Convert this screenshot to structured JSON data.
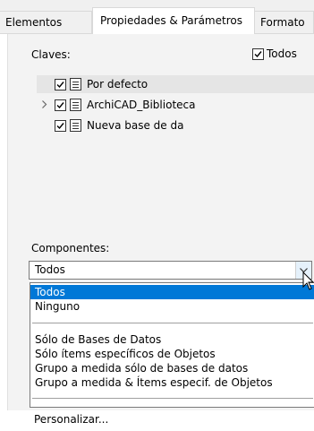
{
  "tabs": [
    {
      "label": "Elementos",
      "active": false
    },
    {
      "label": "Propiedades & Parámetros",
      "active": true
    },
    {
      "label": "Formato",
      "active": false
    }
  ],
  "claves": {
    "label": "Claves:",
    "todos_label": "Todos",
    "todos_checked": true
  },
  "tree": [
    {
      "label": "Por defecto",
      "checked": true,
      "expandable": false,
      "selected": true
    },
    {
      "label": "ArchiCAD_Biblioteca",
      "checked": true,
      "expandable": true,
      "selected": false
    },
    {
      "label": "Nueva base de da",
      "checked": true,
      "expandable": false,
      "selected": false
    }
  ],
  "componentes": {
    "label": "Componentes:",
    "value": "Todos",
    "options": [
      {
        "label": "Todos",
        "highlighted": true
      },
      {
        "label": "Ninguno",
        "highlighted": false
      },
      {
        "label": "Sólo de Bases de Datos",
        "highlighted": false
      },
      {
        "label": "Sólo ítems específicos de Objetos",
        "highlighted": false
      },
      {
        "label": "Grupo a medida sólo de bases de datos",
        "highlighted": false
      },
      {
        "label": "Grupo a medida & Ítems especif. de Objetos",
        "highlighted": false
      },
      {
        "label": "Personalizar...",
        "highlighted": false
      }
    ]
  },
  "icons": {
    "checkbox": "checkbox-checked-icon",
    "database": "database-icon",
    "expander": "chevron-right-icon",
    "dropdown": "chevron-down-icon",
    "cursor": "mouse-pointer-icon"
  },
  "colors": {
    "highlight": "#0078d7",
    "dropdown_button": "#e5f1fb",
    "panel": "#f3f3f3"
  }
}
